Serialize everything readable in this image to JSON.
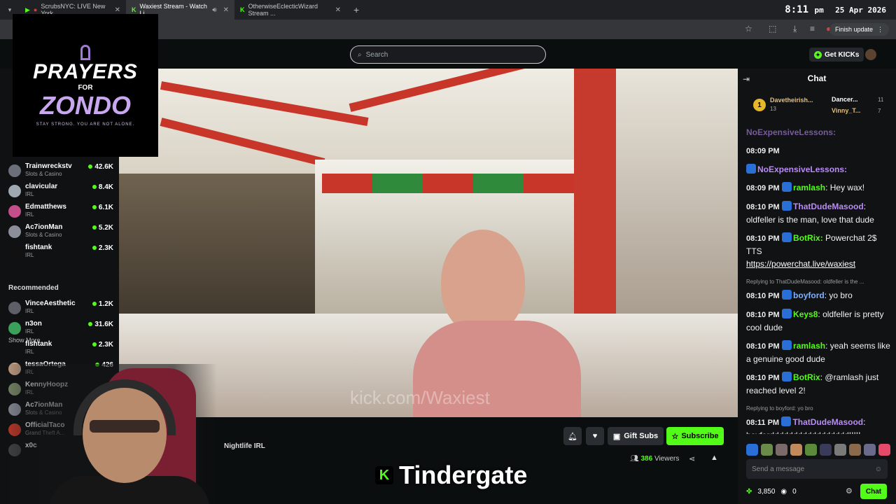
{
  "browser": {
    "tabs": [
      {
        "label": "ScrubsNYC: LIVE New York ..."
      },
      {
        "label": "Waxiest Stream - Watch Li..."
      },
      {
        "label": "OtherwiseEclecticWizard Stream ..."
      }
    ],
    "finish_update": "Finish update"
  },
  "clock": {
    "time": "8:11",
    "ampm": "pm",
    "date": "25 Apr 2026"
  },
  "header": {
    "search_placeholder": "Search",
    "get_kicks": "Get KICKs"
  },
  "logo": {
    "line1": "PRAYERS",
    "line2": "FOR",
    "line3": "ZONDO",
    "tagline": "STAY STRONG. YOU ARE NOT ALONE."
  },
  "sidebar": {
    "following": [
      {
        "name": "Trainwreckstv",
        "category": "Slots & Casino",
        "viewers": "42.6K",
        "color": "#6a6f7a"
      },
      {
        "name": "clavicular",
        "category": "IRL",
        "viewers": "8.4K",
        "color": "#9fa7b0"
      },
      {
        "name": "Edmatthews",
        "category": "IRL",
        "viewers": "6.1K",
        "color": "#c44e8a"
      },
      {
        "name": "Ac7ionMan",
        "category": "Slots & Casino",
        "viewers": "5.2K",
        "color": "#8a8f9a"
      },
      {
        "name": "fishtank",
        "category": "IRL",
        "viewers": "2.3K",
        "color": "#111111"
      }
    ],
    "show_more": "Show More",
    "recommended_title": "Recommended",
    "recommended": [
      {
        "name": "VinceAesthetic",
        "category": "IRL",
        "viewers": "1.2K",
        "color": "#5d5f66"
      },
      {
        "name": "n3on",
        "category": "IRL",
        "viewers": "31.6K",
        "color": "#3aa05a"
      },
      {
        "name": "fishtank",
        "category": "IRL",
        "viewers": "2.3K",
        "color": "#111111"
      },
      {
        "name": "tessaOrtega",
        "category": "IRL",
        "viewers": "426",
        "color": "#c9a58a"
      },
      {
        "name": "KennyHoopz",
        "category": "IRL",
        "viewers": "",
        "color": "#7a8a6a"
      },
      {
        "name": "Ac7ionMan",
        "category": "Slots & Casino",
        "viewers": "",
        "color": "#8a8f9a"
      },
      {
        "name": "OfficialTaco",
        "category": "Grand Theft A...",
        "viewers": "",
        "color": "#c0392b"
      },
      {
        "name": "x0c",
        "category": "",
        "viewers": "",
        "color": "#444444"
      }
    ]
  },
  "video": {
    "watermark": "kick.com/Waxiest"
  },
  "stream": {
    "category": "Nightlife IRL",
    "viewers_count": "386",
    "viewers_label": "Viewers",
    "gift_subs": "Gift Subs",
    "subscribe": "Subscribe",
    "overlay_title": "Tindergate"
  },
  "chat": {
    "title": "Chat",
    "gifters": [
      {
        "name": "Davetheirish...",
        "count": "13"
      },
      {
        "name": "Dancer...",
        "count": "11"
      },
      {
        "name": "Vinny_T...",
        "count": "7"
      }
    ],
    "truncated_top": "NoExpensiveLessons:",
    "messages": [
      {
        "time": "08:09 PM",
        "user": "",
        "text": "",
        "color": "#ffffff"
      },
      {
        "time": "",
        "user": "NoExpensiveLessons:",
        "text": "",
        "color": "#b98cf5"
      },
      {
        "time": "08:09 PM",
        "user": "ramlash",
        "text": ": Hey wax!",
        "color": "#53fc18"
      },
      {
        "time": "08:10 PM",
        "user": "ThatDudeMasood",
        "text": ": oldfeller is the man, love that dude",
        "color": "#b98cf5"
      },
      {
        "time": "08:10 PM",
        "user": "BotRix:",
        "text": " Powerchat 2$ TTS",
        "link": "https://powerchat.live/waxiest",
        "color": "#53fc18"
      },
      {
        "reply": "Replying to ThatDudeMasood: oldfeller is the ...",
        "time": "08:10 PM",
        "user": "boyford",
        "text": ": yo bro",
        "color": "#7fb2ff"
      },
      {
        "time": "08:10 PM",
        "user": "Keys8",
        "text": ": oldfeller is pretty cool dude",
        "color": "#53fc18"
      },
      {
        "time": "08:10 PM",
        "user": "ramlash",
        "text": ": yeah seems like a genuine good dude",
        "color": "#53fc18"
      },
      {
        "time": "08:10 PM",
        "user": "BotRix",
        "text": ": @ramlash just reached level 2!",
        "color": "#53fc18"
      },
      {
        "reply": "Replying to boyford: yo bro",
        "time": "08:11 PM",
        "user": "ThatDudeMasood",
        "text": ": boyforddddddddddddddddd!!!!!",
        "color": "#b98cf5"
      }
    ],
    "send_placeholder": "Send a message",
    "points": "3,850",
    "zero": "0",
    "chat_button": "Chat"
  }
}
